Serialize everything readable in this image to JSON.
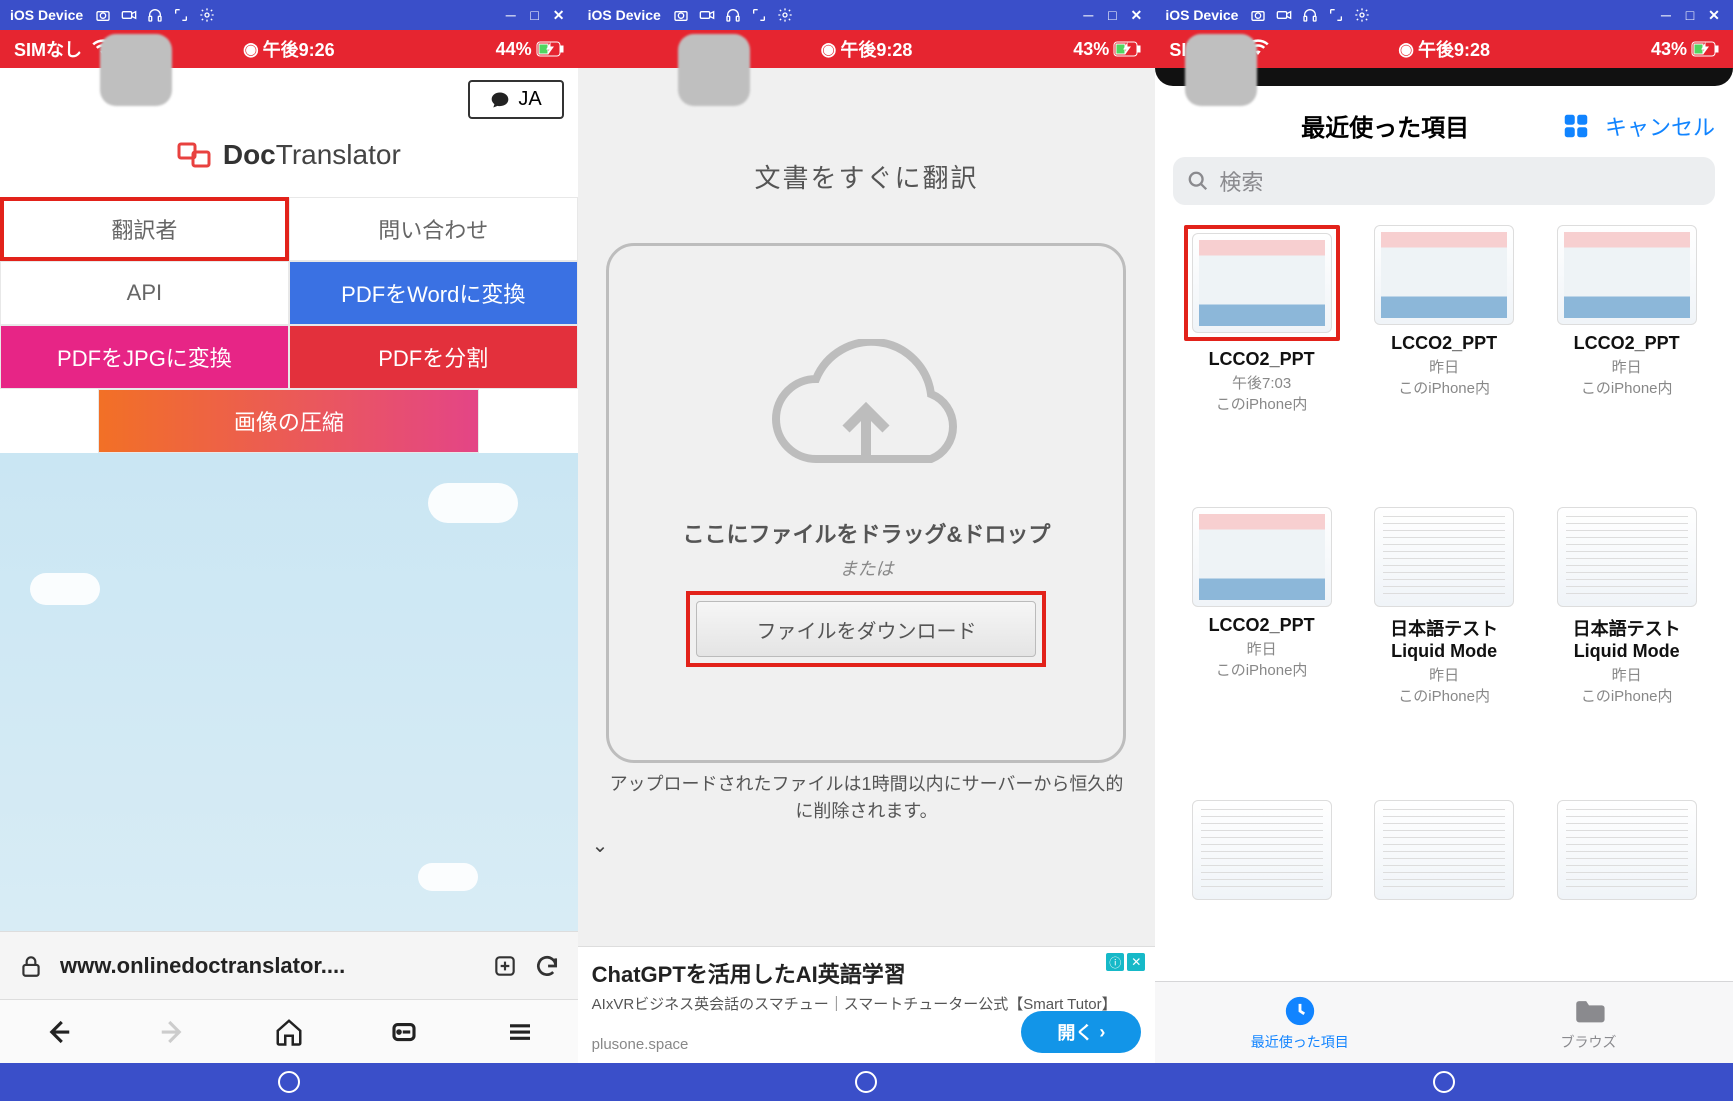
{
  "win": {
    "title": "iOS Device",
    "min": "─",
    "sq": "□",
    "x": "✕"
  },
  "status1": {
    "sim": "SIMなし",
    "time": "午後9:26",
    "batt": "44%"
  },
  "status2": {
    "time": "午後9:28",
    "batt": "43%"
  },
  "status3": {
    "sim": "SIMなし",
    "time": "午後9:28",
    "batt": "43%"
  },
  "p1": {
    "ja": "JA",
    "logo1": "Doc",
    "logo2": "Translator",
    "nav": [
      "翻訳者",
      "問い合わせ",
      "API",
      "PDFをWordに変換",
      "PDFをJPGに変換",
      "PDFを分割",
      "画像の圧縮"
    ],
    "url": "www.onlinedoctranslator...."
  },
  "p2": {
    "title": "文書をすぐに翻訳",
    "dz": "ここにファイルをドラッグ&ドロップ",
    "or": "または",
    "btn": "ファイルをダウンロード",
    "note": "アップロードされたファイルは1時間以内にサーバーから恒久的に削除されます。",
    "ad_h": "ChatGPTを活用したAI英語学習",
    "ad_s": "AIxVRビジネス英会話のスマチュー｜スマートチューター公式【Smart Tutor】",
    "ad_dom": "plusone.space",
    "open": "開く"
  },
  "p3": {
    "title": "最近使った項目",
    "cancel": "キャンセル",
    "search": "検索",
    "files": [
      {
        "name": "LCCO2_PPT",
        "time": "午後7:03",
        "loc": "このiPhone内",
        "t": "ppt",
        "hl": true
      },
      {
        "name": "LCCO2_PPT",
        "time": "昨日",
        "loc": "このiPhone内",
        "t": "ppt"
      },
      {
        "name": "LCCO2_PPT",
        "time": "昨日",
        "loc": "このiPhone内",
        "t": "ppt"
      },
      {
        "name": "LCCO2_PPT",
        "time": "昨日",
        "loc": "このiPhone内",
        "t": "ppt"
      },
      {
        "name": "日本語テスト",
        "sub": "Liquid Mode",
        "time": "昨日",
        "loc": "このiPhone内",
        "t": "doc"
      },
      {
        "name": "日本語テスト",
        "sub": "Liquid Mode",
        "time": "昨日",
        "loc": "このiPhone内",
        "t": "doc"
      },
      {
        "name": "",
        "time": "",
        "loc": "",
        "t": "doc"
      },
      {
        "name": "",
        "time": "",
        "loc": "",
        "t": "doc"
      },
      {
        "name": "",
        "time": "",
        "loc": "",
        "t": "doc"
      }
    ],
    "tab1": "最近使った項目",
    "tab2": "ブラウズ"
  }
}
